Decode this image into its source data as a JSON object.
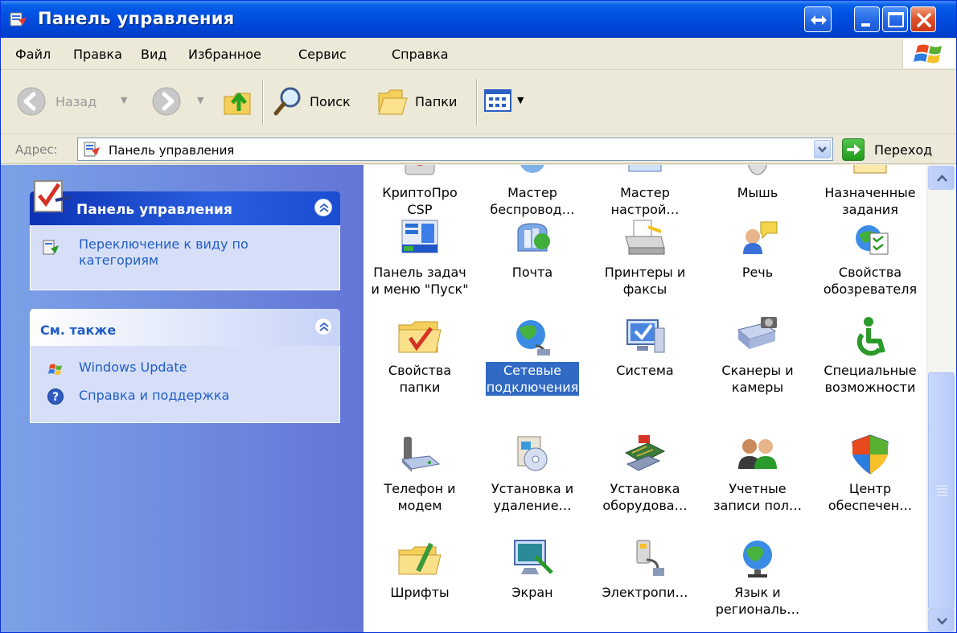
{
  "window": {
    "title": "Панель управления"
  },
  "menu": {
    "items": [
      "Файл",
      "Правка",
      "Вид",
      "Избранное",
      "Сервис",
      "Справка"
    ]
  },
  "toolbar": {
    "back_label": "Назад",
    "search_label": "Поиск",
    "folders_label": "Папки"
  },
  "address": {
    "label": "Адрес:",
    "value": "Панель управления",
    "go_label": "Переход"
  },
  "left_pane": {
    "control_panel": {
      "title": "Панель управления",
      "switch_view": "Переключение к виду по\nкатегориям"
    },
    "see_also": {
      "title": "См. также",
      "links": [
        "Windows Update",
        "Справка и поддержка"
      ]
    }
  },
  "items": [
    {
      "label": "КриптоПро\nCSP",
      "icon": "cryptopro-icon"
    },
    {
      "label": "Мастер\nбеспровод…",
      "icon": "wireless-wizard-icon"
    },
    {
      "label": "Мастер\nнастрой…",
      "icon": "network-wizard-icon"
    },
    {
      "label": "Мышь",
      "icon": "mouse-icon"
    },
    {
      "label": "Назначенные\nзадания",
      "icon": "scheduled-tasks-icon"
    },
    {
      "label": "Панель задач\nи меню \"Пуск\"",
      "icon": "taskbar-icon"
    },
    {
      "label": "Почта",
      "icon": "mail-icon"
    },
    {
      "label": "Принтеры и\nфаксы",
      "icon": "printer-icon"
    },
    {
      "label": "Речь",
      "icon": "speech-icon"
    },
    {
      "label": "Свойства\nобозревателя",
      "icon": "internet-options-icon"
    },
    {
      "label": "Свойства\nпапки",
      "icon": "folder-options-icon"
    },
    {
      "label": "Сетевые\nподключения",
      "icon": "network-connections-icon",
      "selected": true
    },
    {
      "label": "Система",
      "icon": "system-icon"
    },
    {
      "label": "Сканеры и\nкамеры",
      "icon": "scanner-icon"
    },
    {
      "label": "Специальные\nвозможности",
      "icon": "accessibility-icon"
    },
    {
      "label": "Телефон и\nмодем",
      "icon": "phone-modem-icon"
    },
    {
      "label": "Установка и\nудаление…",
      "icon": "add-remove-programs-icon"
    },
    {
      "label": "Установка\nоборудова…",
      "icon": "add-hardware-icon"
    },
    {
      "label": "Учетные\nзаписи пол…",
      "icon": "user-accounts-icon"
    },
    {
      "label": "Центр\nобеспечен…",
      "icon": "security-center-icon"
    },
    {
      "label": "Шрифты",
      "icon": "fonts-icon"
    },
    {
      "label": "Экран",
      "icon": "display-icon"
    },
    {
      "label": "Электропи…",
      "icon": "power-options-icon"
    },
    {
      "label": "Язык и\nрегиональ…",
      "icon": "regional-settings-icon"
    }
  ],
  "colors": {
    "titlebar": "#0055e5",
    "selection": "#316ac5",
    "task_link": "#215dc6"
  }
}
